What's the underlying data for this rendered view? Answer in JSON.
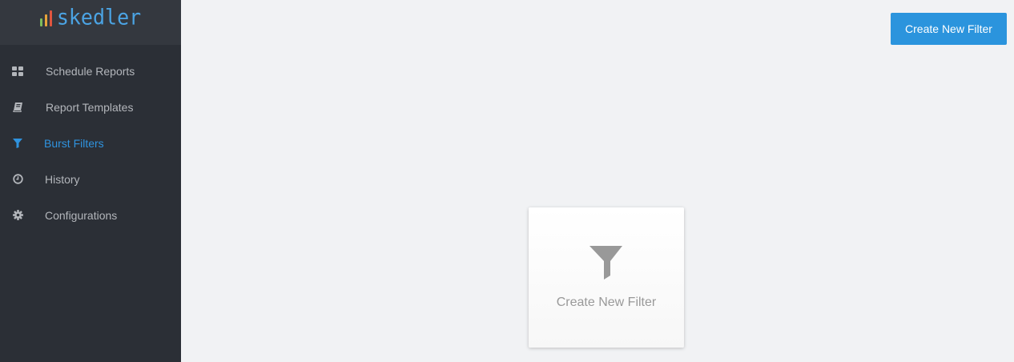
{
  "app": {
    "logo_text": "skedler",
    "logo_bar_colors": [
      "#7dbb5b",
      "#e8a33a",
      "#e0553f"
    ]
  },
  "sidebar": {
    "items": [
      {
        "label": "Schedule Reports",
        "icon": "dashboard-grid-icon",
        "active": false
      },
      {
        "label": "Report Templates",
        "icon": "book-icon",
        "active": false
      },
      {
        "label": "Burst Filters",
        "icon": "filter-icon",
        "active": true
      },
      {
        "label": "History",
        "icon": "clock-icon",
        "active": false
      },
      {
        "label": "Configurations",
        "icon": "gear-icon",
        "active": false
      }
    ]
  },
  "toolbar": {
    "create_label": "Create New Filter"
  },
  "empty_state": {
    "icon": "filter-icon",
    "label": "Create New Filter"
  },
  "colors": {
    "accent": "#2b94dd",
    "sidebar_bg": "#2b2f36",
    "active_nav": "#2f93df",
    "main_bg": "#f1f2f4"
  }
}
